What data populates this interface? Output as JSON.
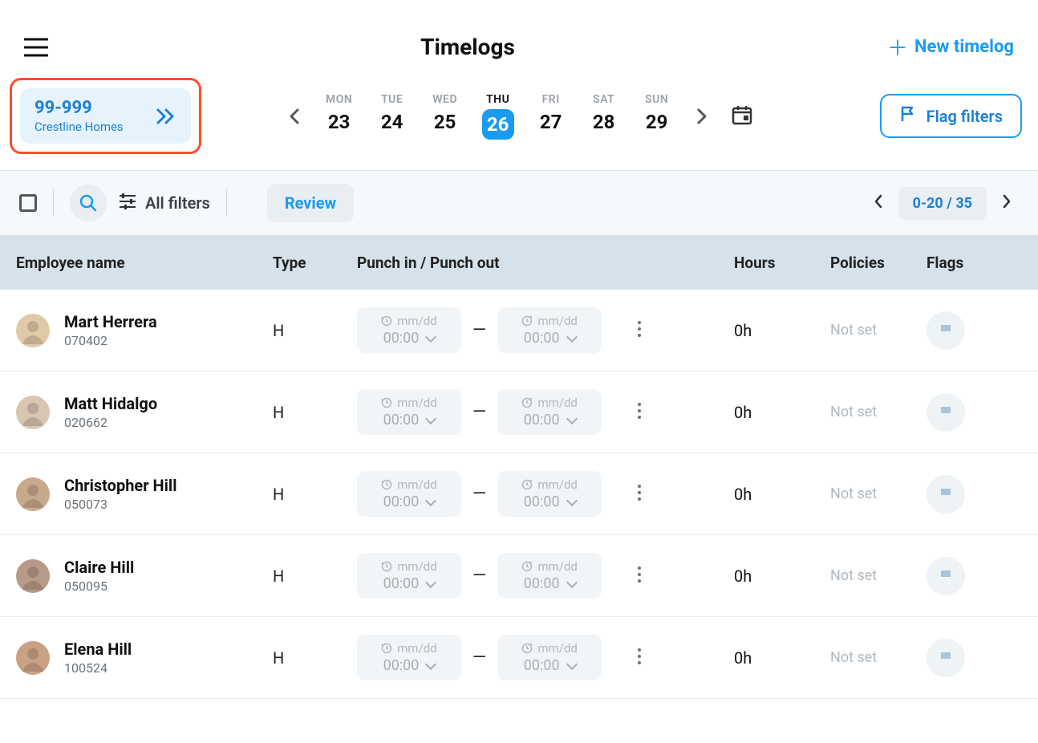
{
  "header": {
    "title": "Timelogs",
    "new_label": "New timelog"
  },
  "project": {
    "code": "99-999",
    "name": "Crestline Homes"
  },
  "calendar": {
    "days": [
      {
        "label": "MON",
        "num": "23",
        "active": false
      },
      {
        "label": "TUE",
        "num": "24",
        "active": false
      },
      {
        "label": "WED",
        "num": "25",
        "active": false
      },
      {
        "label": "THU",
        "num": "26",
        "active": true
      },
      {
        "label": "FRI",
        "num": "27",
        "active": false
      },
      {
        "label": "SAT",
        "num": "28",
        "active": false
      },
      {
        "label": "SUN",
        "num": "29",
        "active": false
      }
    ]
  },
  "flag_filters_label": "Flag filters",
  "toolbar": {
    "all_filters": "All filters",
    "review": "Review",
    "pager": "0-20 / 35"
  },
  "columns": {
    "name": "Employee name",
    "type": "Type",
    "punch": "Punch in / Punch out",
    "hours": "Hours",
    "policies": "Policies",
    "flags": "Flags"
  },
  "punch_placeholder": {
    "date": "mm/dd",
    "time": "00:00"
  },
  "rows": [
    {
      "name": "Mart Herrera",
      "id": "070402",
      "type": "H",
      "hours": "0h",
      "policies": "Not set",
      "avatar": "#e0c9a6"
    },
    {
      "name": "Matt Hidalgo",
      "id": "020662",
      "type": "H",
      "hours": "0h",
      "policies": "Not set",
      "avatar": "#d9c6b0"
    },
    {
      "name": "Christopher Hill",
      "id": "050073",
      "type": "H",
      "hours": "0h",
      "policies": "Not set",
      "avatar": "#c9a98c"
    },
    {
      "name": "Claire Hill",
      "id": "050095",
      "type": "H",
      "hours": "0h",
      "policies": "Not set",
      "avatar": "#b89a88"
    },
    {
      "name": "Elena Hill",
      "id": "100524",
      "type": "H",
      "hours": "0h",
      "policies": "Not set",
      "avatar": "#caa183"
    }
  ]
}
